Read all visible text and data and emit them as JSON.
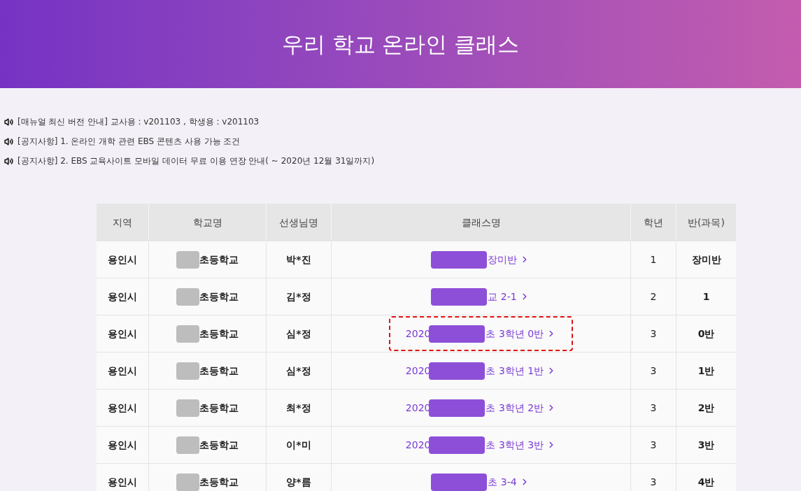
{
  "header": {
    "title": "우리 학교 온라인 클래스"
  },
  "notices": [
    {
      "text": "[매뉴얼 최신 버전 안내] 교사용 : v201103 , 학생용 : v201103"
    },
    {
      "text": "[공지사항] 1. 온라인 개학 관련 EBS 콘텐츠 사용 가능 조건"
    },
    {
      "text": "[공지사항] 2. EBS 교육사이트 모바일 데이터 무료 이용 연장 안내( ~ 2020년 12월 31일까지)"
    }
  ],
  "table": {
    "columns": [
      "지역",
      "학교명",
      "선생님명",
      "클래스명",
      "학년",
      "반(과목)"
    ],
    "rows": [
      {
        "region": "용인시",
        "school": "초등학교",
        "teacher": "박*진",
        "class_before": "",
        "class_after": "장미반",
        "grade": "1",
        "section": "장미반",
        "highlighted": false
      },
      {
        "region": "용인시",
        "school": "초등학교",
        "teacher": "김*정",
        "class_before": "",
        "class_after": "교 2-1",
        "grade": "2",
        "section": "1",
        "highlighted": false
      },
      {
        "region": "용인시",
        "school": "초등학교",
        "teacher": "심*정",
        "class_before": "2020",
        "class_after": "초 3학년 0반",
        "grade": "3",
        "section": "0반",
        "highlighted": true
      },
      {
        "region": "용인시",
        "school": "초등학교",
        "teacher": "심*정",
        "class_before": "2020",
        "class_after": "초 3학년 1반",
        "grade": "3",
        "section": "1반",
        "highlighted": false
      },
      {
        "region": "용인시",
        "school": "초등학교",
        "teacher": "최*정",
        "class_before": "2020",
        "class_after": "초 3학년 2반",
        "grade": "3",
        "section": "2반",
        "highlighted": false
      },
      {
        "region": "용인시",
        "school": "초등학교",
        "teacher": "이*미",
        "class_before": "2020",
        "class_after": "초 3학년 3반",
        "grade": "3",
        "section": "3반",
        "highlighted": false
      },
      {
        "region": "용인시",
        "school": "초등학교",
        "teacher": "양*름",
        "class_before": "",
        "class_after": "초 3-4",
        "grade": "3",
        "section": "4반",
        "highlighted": false
      }
    ]
  }
}
